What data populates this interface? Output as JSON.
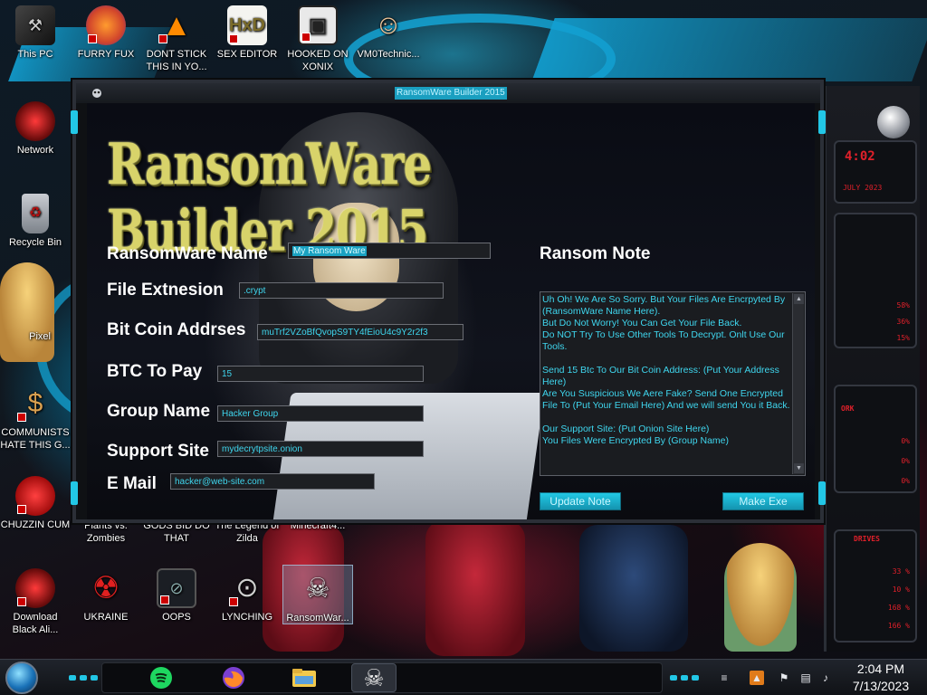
{
  "desktop": {
    "icons": [
      {
        "label": "This PC",
        "glyph": "computer-icon"
      },
      {
        "label": "FURRY FUX",
        "glyph": "firefox-icon"
      },
      {
        "label": "DONT STICK THIS IN YO...",
        "glyph": "vlc-cone-icon"
      },
      {
        "label": "SEX EDITOR",
        "glyph": "hxd-editor-icon"
      },
      {
        "label": "HOOKED ON XONIX",
        "glyph": "xonix-game-icon"
      },
      {
        "label": "VM0Technic...",
        "glyph": "doctor-icon"
      },
      {
        "label": "Network",
        "glyph": "network-globe-icon"
      },
      {
        "label": "Recycle Bin",
        "glyph": "recycle-bin-icon"
      },
      {
        "label": "Pixel",
        "glyph": "cartoon-icon"
      },
      {
        "label": "COMMUNISTS HATE THIS G...",
        "glyph": "money-bag-icon"
      },
      {
        "label": "CHUZZIN CUM",
        "glyph": "chuzzle-icon"
      },
      {
        "label": "Plants vs. Zombies",
        "glyph": "plants-icon"
      },
      {
        "label": "GODS BID DO THAT",
        "glyph": "god-icon"
      },
      {
        "label": "The Legend of Zilda",
        "glyph": "zelda-icon"
      },
      {
        "label": "Minecraft4...",
        "glyph": "minecraft-icon"
      },
      {
        "label": "Download Black Ali...",
        "glyph": "alien-icon"
      },
      {
        "label": "UKRAINE",
        "glyph": "radiation-icon"
      },
      {
        "label": "OOPS",
        "glyph": "monitor-icon"
      },
      {
        "label": "LYNCHING",
        "glyph": "noose-icon"
      },
      {
        "label": "RansomWar...",
        "glyph": "skull-icon"
      }
    ]
  },
  "widget": {
    "time_text": "4:02",
    "date_text": "JULY 2023",
    "percent_values": [
      "58%",
      "36%",
      "15%"
    ],
    "work_label": "ORK",
    "drives_label": "DRIVES",
    "drive_values": [
      "0%",
      "0%",
      "0%"
    ],
    "bottom_values": [
      "33 %",
      "10 %",
      "168 %",
      "166 %"
    ]
  },
  "window": {
    "title": "RansomWare Builder 2015",
    "banner": "RansomWare Builder 2015",
    "fields": {
      "name_label": "RansomWare Name",
      "name_value": "My Ransom Ware",
      "ext_label": "File Extnesion",
      "ext_value": ".crypt",
      "btc_addr_label": "Bit Coin Addrses",
      "btc_addr_value": "muTrf2VZoBfQvopS9TY4fEioU4c9Y2r2f3",
      "btc_pay_label": "BTC To Pay",
      "btc_pay_value": "15",
      "group_label": "Group Name",
      "group_value": "Hacker Group",
      "site_label": "Support Site",
      "site_value": "mydecrytpsite.onion",
      "email_label": "E Mail",
      "email_value": "hacker@web-site.com"
    },
    "note_label": "Ransom Note",
    "note_text": "Uh Oh! We Are So Sorry. But Your Files Are Encrpyted By (RansomWare Name Here).\nBut Do Not Worry! You Can Get Your File Back.\nDo NOT Try To Use Other Tools To Decrypt. Onlt Use Our Tools.\n\nSend 15 Btc To Our Bit Coin Address: (Put Your Address Here)\nAre You Suspicious We Aere Fake? Send One Encrypted File To (Put Your Email Here) And we will send You it Back.\n\nOur Support Site: (Put Onion Site Here)\nYou Files Were Encrypted By (Group Name)",
    "update_button": "Update Note",
    "make_button": "Make Exe"
  },
  "taskbar": {
    "apps": [
      "start-orb",
      "spotify-icon",
      "firefox-icon",
      "file-explorer-icon",
      "ransomware-builder-icon"
    ],
    "clock_time": "2:04 PM",
    "clock_date": "7/13/2023"
  },
  "colors": {
    "accent_cyan": "#22c7e6",
    "field_text": "#3fd6ee",
    "banner_gold": "#d8d36a",
    "widget_red": "#e0202a"
  }
}
